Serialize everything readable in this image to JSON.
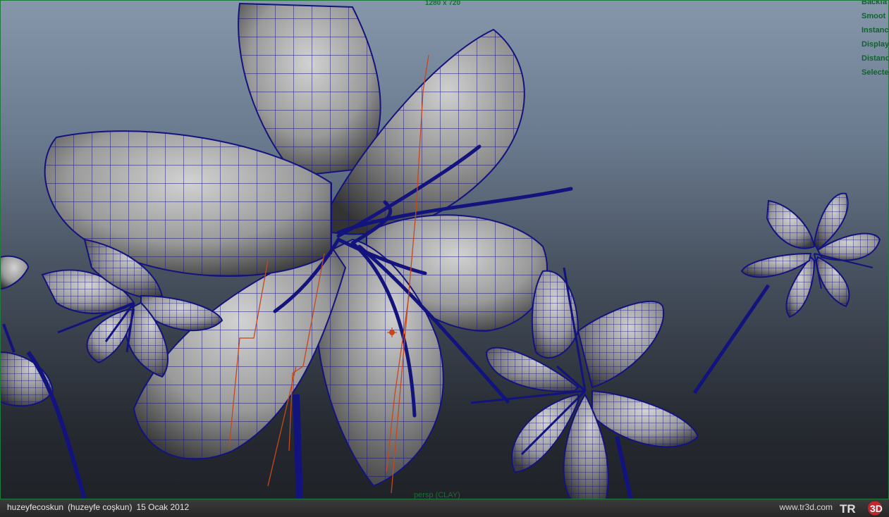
{
  "viewport": {
    "resolution_label": "1280 x 720",
    "camera_label": "persp (CLAY)",
    "hud_items": [
      "Backfa",
      "Smoot",
      "Instanc",
      "Display",
      "Distanc",
      "Selecte"
    ]
  },
  "footer": {
    "username": "huzeyfecoskun",
    "fullname": "(huzeyfe coşkun)",
    "date": "15 Ocak 2012",
    "site": "www.tr3d.com",
    "logo_text": "TR3D"
  },
  "colors": {
    "wire": "#13137e",
    "petal_light": "#c8c8c8",
    "petal_dark": "#3a3a3a",
    "curve": "#c8461c",
    "hud_text": "#10622f"
  },
  "icons": [
    "manipulator-icon",
    "tr3d-logo"
  ]
}
